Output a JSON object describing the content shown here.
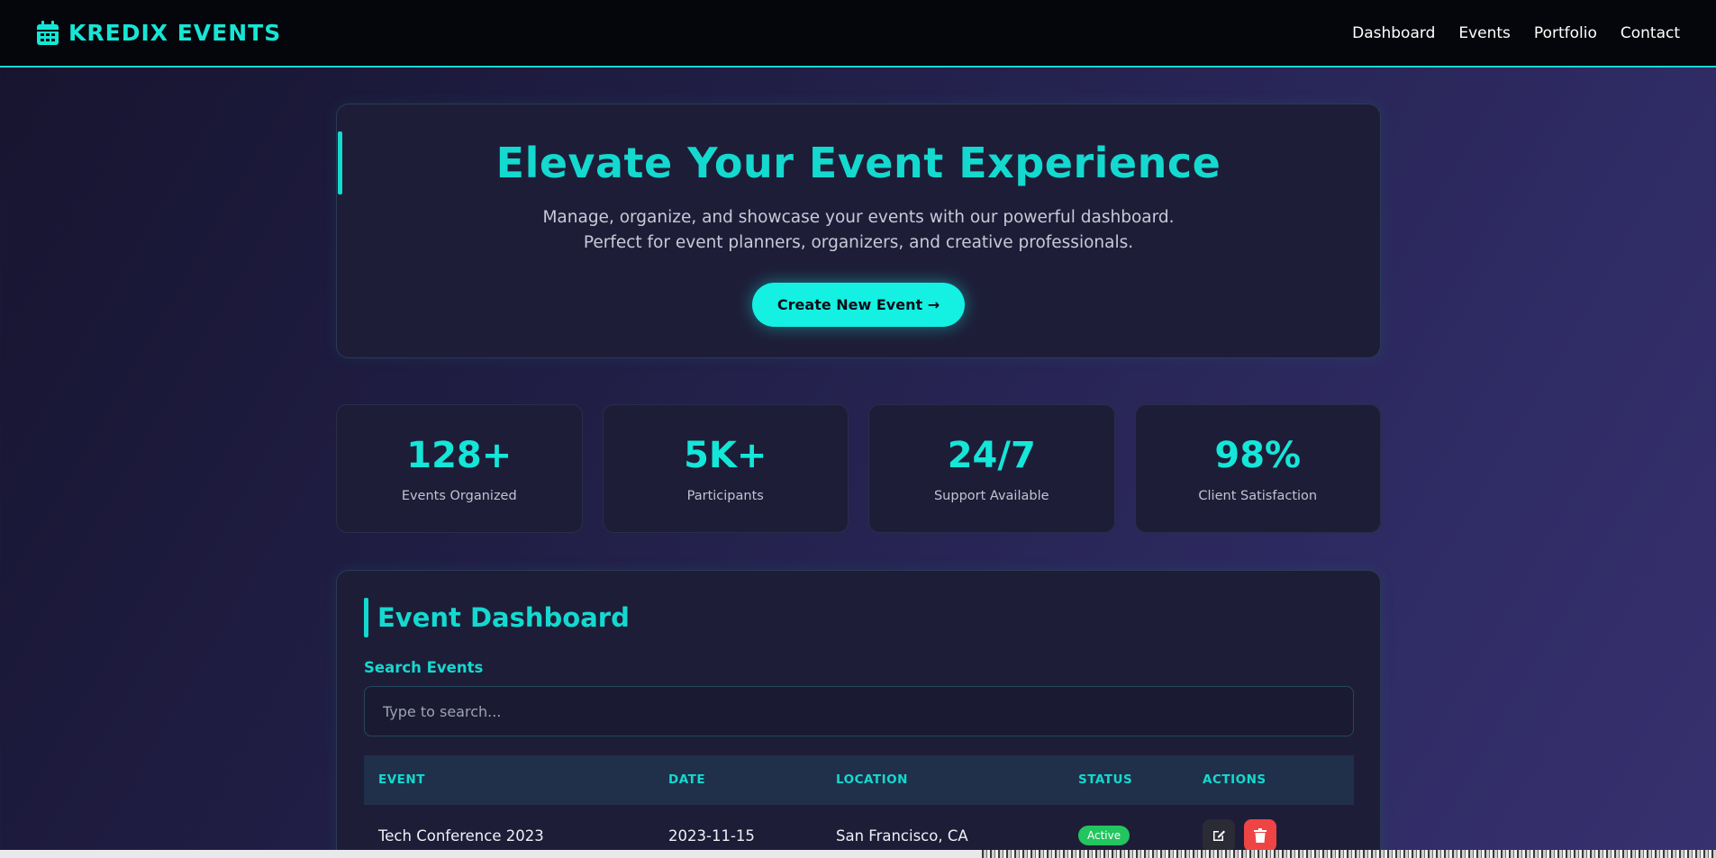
{
  "nav": {
    "brand": "KREDIX EVENTS",
    "links": [
      "Dashboard",
      "Events",
      "Portfolio",
      "Contact"
    ]
  },
  "hero": {
    "title": "Elevate Your Event Experience",
    "subtitle_line1": "Manage, organize, and showcase your events with our powerful dashboard.",
    "subtitle_line2": "Perfect for event planners, organizers, and creative professionals.",
    "cta": "Create New Event",
    "cta_arrow": "→"
  },
  "stats": [
    {
      "value": "128+",
      "label": "Events Organized"
    },
    {
      "value": "5K+",
      "label": "Participants"
    },
    {
      "value": "24/7",
      "label": "Support Available"
    },
    {
      "value": "98%",
      "label": "Client Satisfaction"
    }
  ],
  "dashboard": {
    "title": "Event Dashboard",
    "search_label": "Search Events",
    "search_placeholder": "Type to search...",
    "columns": [
      "EVENT",
      "DATE",
      "LOCATION",
      "STATUS",
      "ACTIONS"
    ],
    "rows": [
      {
        "event": "Tech Conference 2023",
        "date": "2023-11-15",
        "location": "San Francisco, CA",
        "status": "Active"
      }
    ]
  },
  "icons": {
    "brand": "calendar-icon",
    "edit": "edit-icon",
    "delete": "trash-icon"
  },
  "colors": {
    "accent": "#14d9cf",
    "background": "#221f48",
    "status_active": "#22c55e",
    "delete": "#ef4444"
  }
}
